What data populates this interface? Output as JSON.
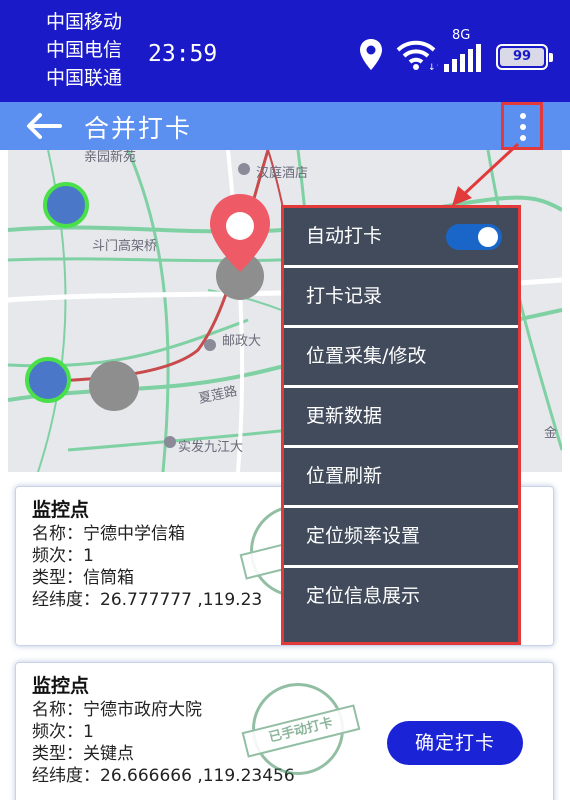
{
  "status_bar": {
    "carriers": [
      "中国移动",
      "中国电信",
      "中国联通"
    ],
    "time": "23:59",
    "network": "8G",
    "battery": "99",
    "icons": [
      "location-icon",
      "wifi-icon",
      "signal-icon",
      "battery-icon"
    ]
  },
  "app_bar": {
    "title": "合并打卡",
    "back_icon": "back-arrow-icon",
    "more_icon": "more-vertical-icon"
  },
  "map": {
    "labels": [
      "亲园新苑",
      "汉庭酒店",
      "斗门高架桥",
      "邮政大",
      "夏莲路",
      "实发九江大",
      "金"
    ]
  },
  "menu": {
    "items": [
      {
        "label": "自动打卡",
        "toggle": true
      },
      {
        "label": "打卡记录"
      },
      {
        "label": "位置采集/修改"
      },
      {
        "label": "更新数据"
      },
      {
        "label": "位置刷新"
      },
      {
        "label": "定位频率设置"
      },
      {
        "label": "定位信息展示"
      }
    ]
  },
  "cards": [
    {
      "title": "监控点",
      "name": "名称：宁德中学信箱",
      "frequency": "频次：1",
      "type": "类型：信筒箱",
      "coords": "经纬度：26.777777 ,119.23",
      "stamp": "已"
    },
    {
      "title": "监控点",
      "name": "名称：宁德市政府大院",
      "frequency": "频次：1",
      "type": "类型：关键点",
      "coords": "经纬度：26.666666 ,119.23456",
      "stamp": "已手动打卡",
      "button": "确定打卡"
    }
  ],
  "colors": {
    "status_bar": "#1a1ac8",
    "app_bar": "#5b8ff0",
    "menu_bg": "#414b5c",
    "highlight": "#e23a3a",
    "button": "#1b23d6",
    "stamp": "#3a8a5a"
  }
}
